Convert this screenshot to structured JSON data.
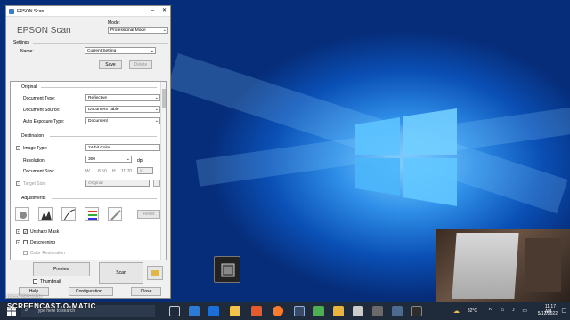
{
  "window": {
    "title": "EPSON Scan",
    "brand": "EPSON Scan",
    "mode_label": "Mode:",
    "mode_value": "Professional Mode"
  },
  "settings": {
    "heading": "Settings",
    "name_label": "Name:",
    "name_value": "Current Setting",
    "save_label": "Save",
    "delete_label": "Delete"
  },
  "original": {
    "heading": "Original",
    "document_type_label": "Document Type:",
    "document_type_value": "Reflective",
    "document_source_label": "Document Source:",
    "document_source_value": "Document Table",
    "auto_exposure_label": "Auto Exposure Type:",
    "auto_exposure_value": "Document"
  },
  "destination": {
    "heading": "Destination",
    "image_type_label": "Image Type:",
    "image_type_value": "24-bit Color",
    "resolution_label": "Resolution:",
    "resolution_value": "300",
    "resolution_unit": "dpi",
    "document_size_label": "Document Size:",
    "w_label": "W",
    "w_value": "8.50",
    "h_label": "H",
    "h_value": "11.70",
    "size_unit": "in.",
    "target_size_label": "Target Size:",
    "target_size_value": "Original"
  },
  "adjustments": {
    "heading": "Adjustments",
    "reset_label": "Reset",
    "unsharp_mask_label": "Unsharp Mask",
    "descreening_label": "Descreening",
    "color_restoration_label": "Color Restoration"
  },
  "footer": {
    "preview_label": "Preview",
    "scan_label": "Scan",
    "thumbnail_label": "Thumbnail",
    "help_label": "Help",
    "configuration_label": "Configuration...",
    "close_label": "Close"
  },
  "taskbar": {
    "search_placeholder": "Type here to search",
    "temperature": "32°C",
    "time": "11:17 AM",
    "date": "5/12/2022"
  },
  "overlay": {
    "watermark": "SCREENCAST-O-MATIC",
    "recorded_with": "RECORDED WITH"
  },
  "colors": {
    "desktop_accent": "#2f8fe8",
    "taskbar": "#1f2a3a"
  }
}
